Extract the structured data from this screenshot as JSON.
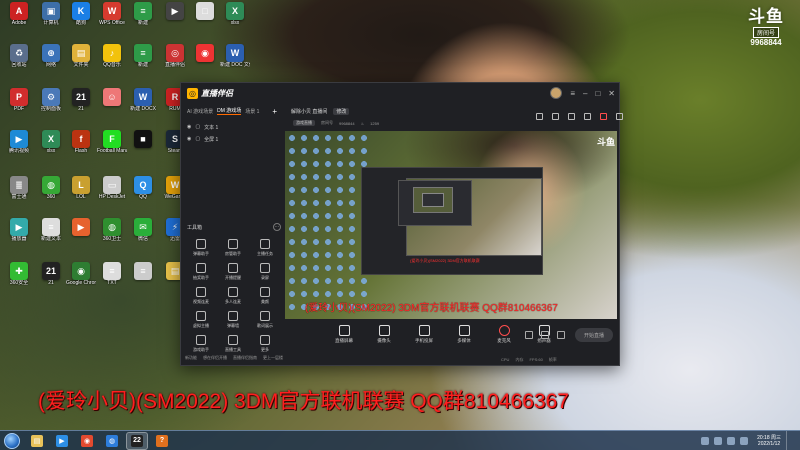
{
  "desktop": {
    "icons": [
      {
        "label": "Adobe",
        "glyph": "A",
        "color": "#cc2222"
      },
      {
        "label": "计算机",
        "glyph": "▣",
        "color": "#3d6fa8"
      },
      {
        "label": "酷狗",
        "glyph": "K",
        "color": "#1a7fe6"
      },
      {
        "label": "WPS Office",
        "glyph": "W",
        "color": "#d63b2f"
      },
      {
        "label": "新建",
        "glyph": "≡",
        "color": "#2e9b48"
      },
      {
        "label": "",
        "glyph": "▶",
        "color": "#444"
      },
      {
        "label": "",
        "glyph": "□",
        "color": "#ddd"
      },
      {
        "label": "xlsx",
        "glyph": "X",
        "color": "#2e8b57"
      },
      {
        "label": "回收站",
        "glyph": "♻",
        "color": "#5a6e8c"
      },
      {
        "label": "网络",
        "glyph": "⊕",
        "color": "#3b73b9"
      },
      {
        "label": "文件夹",
        "glyph": "▤",
        "color": "#e0b23a"
      },
      {
        "label": "QQ音乐",
        "glyph": "♪",
        "color": "#f2c20c"
      },
      {
        "label": "新建",
        "glyph": "≡",
        "color": "#2e9b48"
      },
      {
        "label": "直播伴侣",
        "glyph": "◎",
        "color": "#c33"
      },
      {
        "label": "",
        "glyph": "◉",
        "color": "#e33"
      },
      {
        "label": "新建 DOC 文件",
        "glyph": "W",
        "color": "#2b5fb0"
      },
      {
        "label": "PDF",
        "glyph": "P",
        "color": "#d12d2d"
      },
      {
        "label": "控制面板",
        "glyph": "⚙",
        "color": "#4a79b8"
      },
      {
        "label": "21",
        "glyph": "21",
        "color": "#222"
      },
      {
        "label": "",
        "glyph": "☺",
        "color": "#e77"
      },
      {
        "label": "新建 DOCX",
        "glyph": "W",
        "color": "#2b5fb0"
      },
      {
        "label": "RUM",
        "glyph": "R",
        "color": "#c22"
      },
      {
        "label": "计算器",
        "glyph": "▦",
        "color": "#666"
      },
      {
        "label": "Internet Explorer",
        "glyph": "e",
        "color": "#2d7ddb"
      },
      {
        "label": "腾讯视频",
        "glyph": "▶",
        "color": "#1e8ad6"
      },
      {
        "label": "xlsx",
        "glyph": "X",
        "color": "#2e8b57"
      },
      {
        "label": "Flash",
        "glyph": "f",
        "color": "#b31"
      },
      {
        "label": "Football Manager",
        "glyph": "F",
        "color": "#2d2"
      },
      {
        "label": "",
        "glyph": "■",
        "color": "#111"
      },
      {
        "label": "Steam",
        "glyph": "S",
        "color": "#1b2838"
      },
      {
        "label": "HP DeskJet 3630 series",
        "glyph": "▭",
        "color": "#eee"
      },
      {
        "label": "PDF转换",
        "glyph": "P",
        "color": "#2a6bd1"
      },
      {
        "label": "富士通",
        "glyph": "≣",
        "color": "#888"
      },
      {
        "label": "360",
        "glyph": "◍",
        "color": "#36a836"
      },
      {
        "label": "LOL",
        "glyph": "L",
        "color": "#c9a030"
      },
      {
        "label": "HP DeskJet",
        "glyph": "▭",
        "color": "#ccc"
      },
      {
        "label": "QQ",
        "glyph": "Q",
        "color": "#2d8fe6"
      },
      {
        "label": "WeGame",
        "glyph": "W",
        "color": "#e5a20a"
      },
      {
        "label": "QQ浏览器",
        "glyph": "◐",
        "color": "#3a8ee6"
      },
      {
        "label": "mi",
        "glyph": "m",
        "color": "#e33"
      },
      {
        "label": "播放器",
        "glyph": "▶",
        "color": "#3aa"
      },
      {
        "label": "新建文本",
        "glyph": "≡",
        "color": "#ddd"
      },
      {
        "label": "",
        "glyph": "▶",
        "color": "#e6622e"
      },
      {
        "label": "360卫士",
        "glyph": "◍",
        "color": "#2f8f2f"
      },
      {
        "label": "微信",
        "glyph": "✉",
        "color": "#2aae3a"
      },
      {
        "label": "迅雷",
        "glyph": "⚡",
        "color": "#1f6fd6"
      },
      {
        "label": "QQ",
        "glyph": "Q",
        "color": "#e65c00"
      },
      {
        "label": "",
        "glyph": "▲",
        "color": "#2bb"
      },
      {
        "label": "360安全",
        "glyph": "✚",
        "color": "#3b3"
      },
      {
        "label": "21",
        "glyph": "21",
        "color": "#222"
      },
      {
        "label": "Google Chrome",
        "glyph": "◉",
        "color": "#2e7d32"
      },
      {
        "label": "TXT",
        "glyph": "≡",
        "color": "#ddd"
      },
      {
        "label": "",
        "glyph": "≡",
        "color": "#ccc"
      },
      {
        "label": "",
        "glyph": "▤",
        "color": "#e9c24a"
      },
      {
        "label": "Internet Explorer",
        "glyph": "e",
        "color": "#2d7ddb"
      },
      {
        "label": "PTE",
        "glyph": "P",
        "color": "#d33"
      }
    ]
  },
  "brand": {
    "mark": "斗鱼",
    "room_label": "房间号",
    "room_number": "9968844"
  },
  "app": {
    "title": "直播伴侣",
    "scene_tabs": [
      "AI 游戏场景",
      "DM 游戏场",
      "场景 1"
    ],
    "add_scene": "+",
    "sources": [
      {
        "name": "文本 1"
      },
      {
        "name": "全屏 1"
      }
    ],
    "tools_title": "工具箱",
    "tools": [
      {
        "label": "弹幕助手"
      },
      {
        "label": "房管助手"
      },
      {
        "label": "主播任务"
      },
      {
        "label": "抽奖助手"
      },
      {
        "label": "开播提醒"
      },
      {
        "label": "录屏"
      },
      {
        "label": "视频连麦"
      },
      {
        "label": "多人连麦"
      },
      {
        "label": "美颜"
      },
      {
        "label": "虚拟主播"
      },
      {
        "label": "弹幕墙"
      },
      {
        "label": "歌词展示"
      },
      {
        "label": "游戏助手"
      },
      {
        "label": "直播工具"
      },
      {
        "label": "更多"
      }
    ],
    "room_bar": {
      "title": "解除小贝 直播间",
      "tag": "修改"
    },
    "info_bar": {
      "category": "游戏直播",
      "room": "房间号",
      "room_no": "9968844",
      "likes": "1259"
    },
    "preview_overlay": "(爱玲小贝)(SM2022) 3DM官方联机联赛 QQ群810466367",
    "preview_logo": "斗鱼",
    "inner_text": "(爱玲小贝)(SM2022) 3DM官方联机联赛",
    "controls": [
      {
        "label": "直播屏幕",
        "name": "screen-capture"
      },
      {
        "label": "摄像头",
        "name": "camera"
      },
      {
        "label": "手机投屏",
        "name": "phone-cast"
      },
      {
        "label": "多媒体",
        "name": "media"
      },
      {
        "label": "麦克风",
        "name": "microphone"
      },
      {
        "label": "扬声器",
        "name": "speaker"
      }
    ],
    "start_label": "开始直播",
    "tips": [
      "新功能",
      "想在伴侣开播",
      "直播伴侣指南",
      "更上一层楼"
    ],
    "status": [
      "CPU",
      "内存",
      "FPS:60",
      "帧率"
    ]
  },
  "overlay": {
    "text": "(爱玲小贝)(SM2022) 3DM官方联机联赛 QQ群810466367"
  },
  "taskbar": {
    "apps": [
      {
        "glyph": "▤",
        "color": "#e8c25a"
      },
      {
        "glyph": "▶",
        "color": "#2d8fe6"
      },
      {
        "glyph": "◉",
        "color": "#e24a2f"
      },
      {
        "glyph": "◍",
        "color": "#2d7ddb"
      },
      {
        "glyph": "22",
        "color": "#222"
      },
      {
        "glyph": "?",
        "color": "#e0701e"
      }
    ],
    "clock_time": "20:18 周三",
    "clock_date": "2022/1/12"
  }
}
